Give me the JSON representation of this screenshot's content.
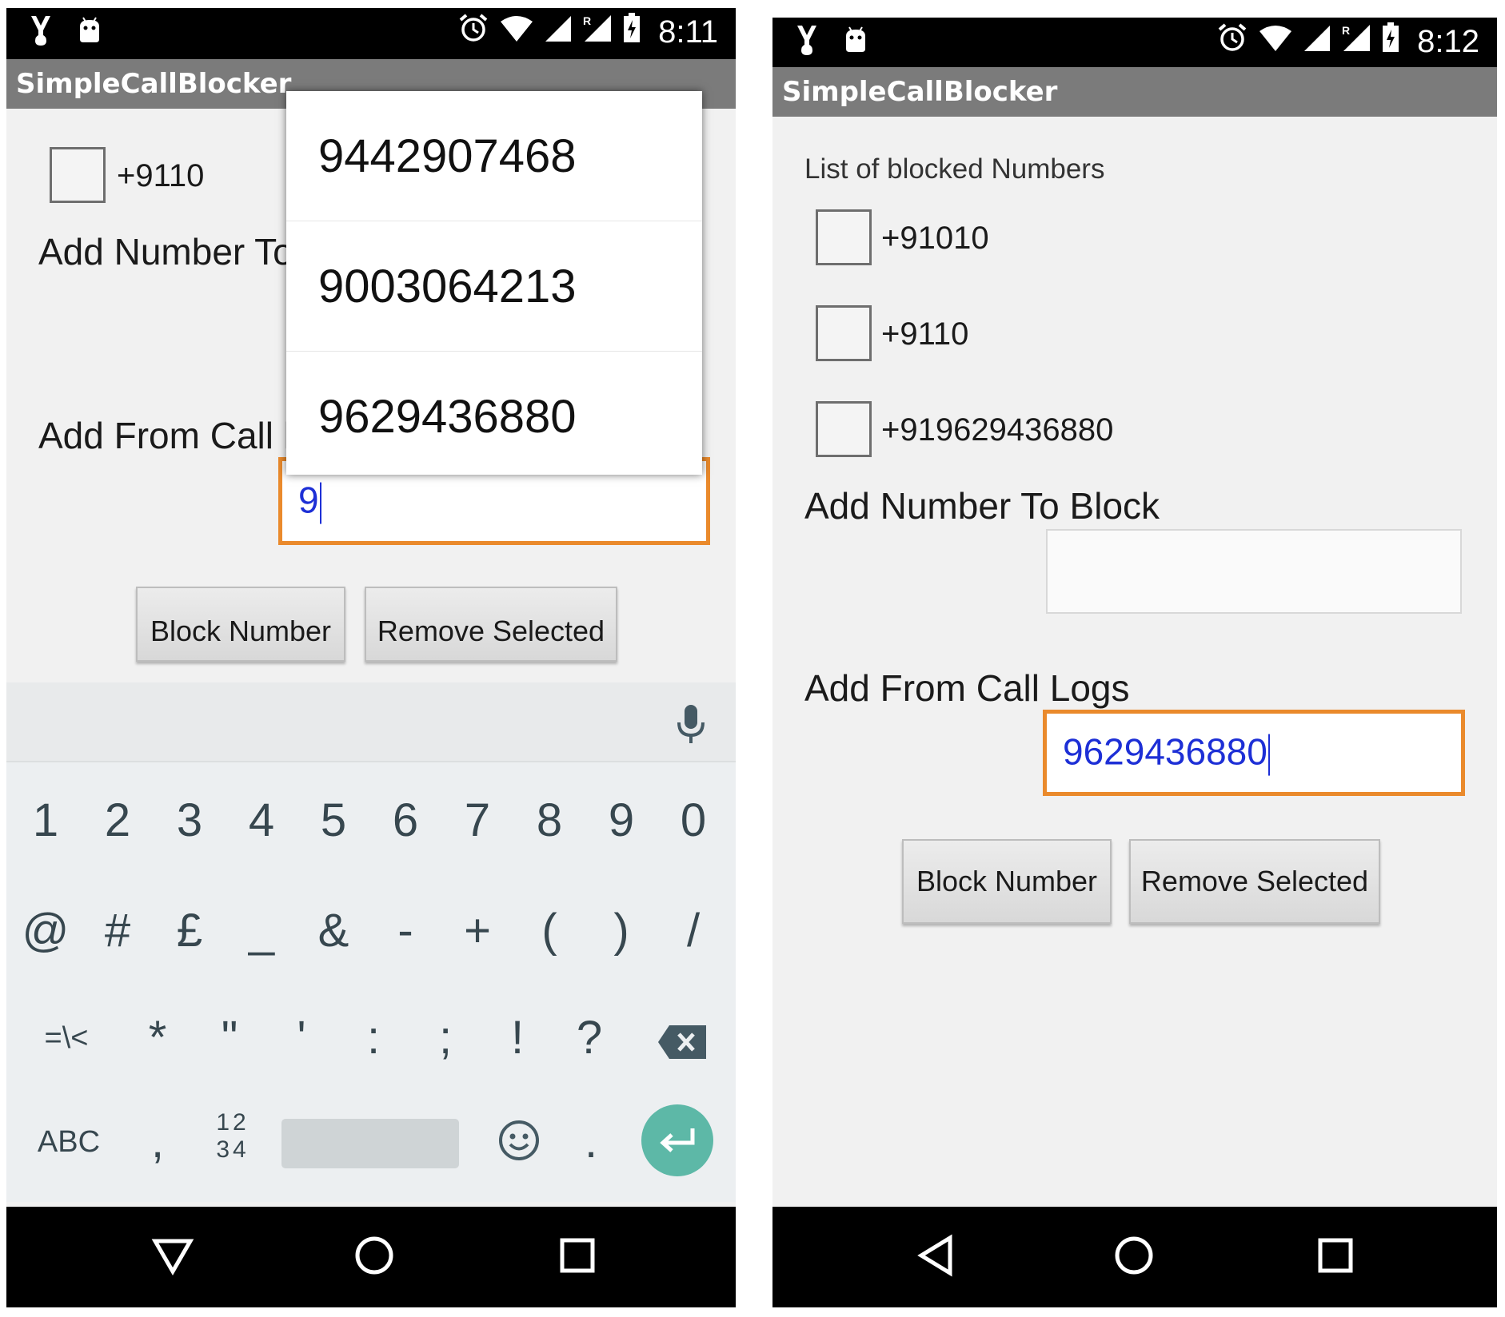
{
  "phone1": {
    "status": {
      "time": "8:11"
    },
    "app_title": "SimpleCallBlocker",
    "blocked_items": [
      {
        "label": "+9110"
      }
    ],
    "add_number_label": "Add Number To",
    "add_from_call_label": "Add From Call l",
    "call_log_input": {
      "value": "9"
    },
    "suggestions": [
      "9442907468",
      "9003064213",
      "9629436880"
    ],
    "block_button": "Block Number",
    "remove_button": "Remove Selected",
    "keyboard": {
      "row1": [
        "1",
        "2",
        "3",
        "4",
        "5",
        "6",
        "7",
        "8",
        "9",
        "0"
      ],
      "row2": [
        "@",
        "#",
        "£",
        "_",
        "&",
        "-",
        "+",
        "(",
        ")",
        "/"
      ],
      "row3": [
        "=\\<",
        "*",
        "\"",
        "'",
        ":",
        ";",
        "!",
        "?"
      ],
      "abc_key": "ABC",
      "comma_key": ",",
      "numpad_key_top": "12",
      "numpad_key_bottom": "34",
      "period_key": "."
    }
  },
  "phone2": {
    "status": {
      "time": "8:12"
    },
    "app_title": "SimpleCallBlocker",
    "list_label": "List of blocked Numbers",
    "blocked_items": [
      {
        "label": "+91010"
      },
      {
        "label": "+9110"
      },
      {
        "label": "+919629436880"
      }
    ],
    "add_number_label": "Add Number To Block",
    "add_number_input": {
      "value": ""
    },
    "add_from_call_label": "Add From Call Logs",
    "call_log_input": {
      "value": "9629436880"
    },
    "block_button": "Block Number",
    "remove_button": "Remove Selected"
  },
  "colors": {
    "status_bar": "#000000",
    "action_bar": "#7b7b7b",
    "focus_border": "#ea8a2c",
    "input_text": "#1d2fd6",
    "enter_key": "#5db8a7"
  },
  "icons": [
    "usb-debug-icon",
    "android-icon",
    "alarm-icon",
    "wifi-icon",
    "cell-signal-icon",
    "roaming-signal-icon",
    "battery-icon",
    "mic-icon",
    "backspace-icon",
    "emoji-icon",
    "enter-icon",
    "back-icon",
    "home-icon",
    "recents-icon"
  ]
}
